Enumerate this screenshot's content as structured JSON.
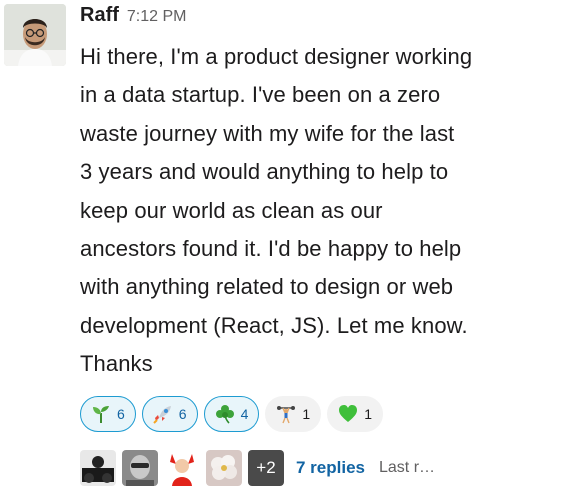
{
  "message": {
    "author": "Raff",
    "time": "7:12 PM",
    "text": "Hi there, I'm a product designer working\nin a data startup. I've been on a zero\nwaste journey with my wife for the last\n3 years and would anything to help to\nkeep our world as clean as our\nancestors found it. I'd be happy to help\nwith anything related to design or web\ndevelopment (React, JS). Let me know.\nThanks"
  },
  "reactions": [
    {
      "icon": "seedling-icon",
      "count": "6"
    },
    {
      "icon": "rocket-icon",
      "count": "6"
    },
    {
      "icon": "shamrock-icon",
      "count": "4"
    },
    {
      "icon": "person-lifting-icon",
      "count": "1"
    },
    {
      "icon": "green-heart-icon",
      "count": "1"
    }
  ],
  "thread": {
    "extra_count": "+2",
    "replies_label": "7 replies",
    "last_label": "Last r…"
  },
  "colors": {
    "link": "#1264a3",
    "own_reaction_border": "#1d9bd1",
    "own_reaction_bg": "#e8f5fa",
    "reaction_bg": "#f2f2f2"
  }
}
